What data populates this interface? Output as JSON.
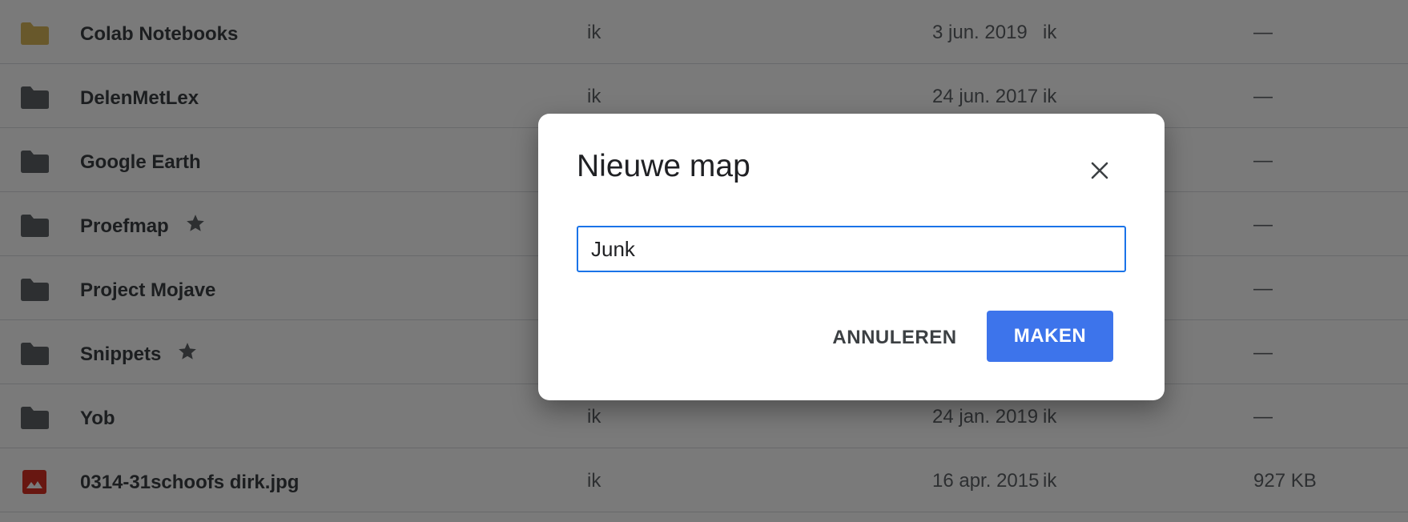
{
  "file_list": {
    "rows": [
      {
        "name": "Colab Notebooks",
        "icon": "folder-shared-icon",
        "icon_color": "#d9b85a",
        "starred": false,
        "owner": "ik",
        "modified": "3 jun. 2019",
        "modified_by": "ik",
        "size": "—"
      },
      {
        "name": "DelenMetLex",
        "icon": "folder-icon",
        "icon_color": "#5f6368",
        "starred": false,
        "owner": "ik",
        "modified": "24 jun. 2017",
        "modified_by": "ik",
        "size": "—"
      },
      {
        "name": "Google Earth",
        "icon": "folder-icon",
        "icon_color": "#5f6368",
        "starred": false,
        "owner": "",
        "modified": "",
        "modified_by": "",
        "size": "—"
      },
      {
        "name": "Proefmap",
        "icon": "folder-icon",
        "icon_color": "#5f6368",
        "starred": true,
        "owner": "",
        "modified": "",
        "modified_by": "",
        "size": "—"
      },
      {
        "name": "Project Mojave",
        "icon": "folder-icon",
        "icon_color": "#5f6368",
        "starred": false,
        "owner": "",
        "modified": "",
        "modified_by": "",
        "size": "—"
      },
      {
        "name": "Snippets",
        "icon": "folder-icon",
        "icon_color": "#5f6368",
        "starred": true,
        "owner": "",
        "modified": "",
        "modified_by": "",
        "size": "—"
      },
      {
        "name": "Yob",
        "icon": "folder-icon",
        "icon_color": "#5f6368",
        "starred": false,
        "owner": "ik",
        "modified": "24 jan. 2019",
        "modified_by": "ik",
        "size": "—"
      },
      {
        "name": "0314-31schoofs dirk.jpg",
        "icon": "image-file-icon",
        "icon_color": "#d93025",
        "starred": false,
        "owner": "ik",
        "modified": "16 apr. 2015",
        "modified_by": "ik",
        "size": "927 KB"
      }
    ]
  },
  "dialog": {
    "title": "Nieuwe map",
    "input_value": "Junk",
    "cancel_label": "ANNULEREN",
    "create_label": "MAKEN",
    "accent_color": "#1a73e8"
  }
}
